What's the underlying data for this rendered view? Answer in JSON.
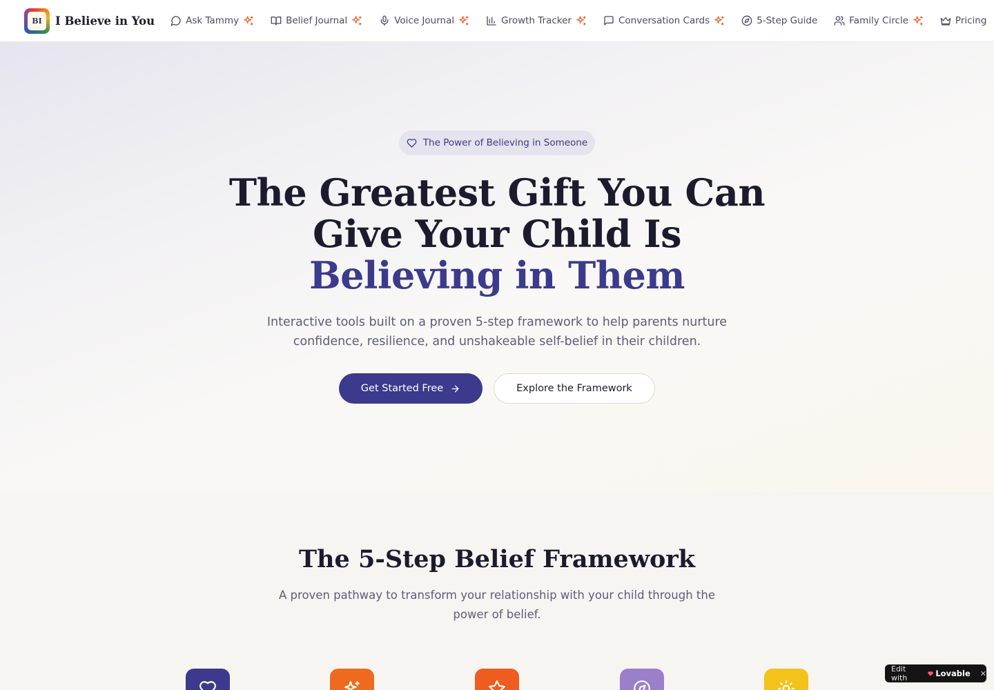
{
  "brand": {
    "logo_text": "BI",
    "name": "I Believe in You"
  },
  "nav": {
    "items": [
      {
        "label": "Ask Tammy",
        "icon": "message-circle-icon",
        "premium": true
      },
      {
        "label": "Belief Journal",
        "icon": "book-open-icon",
        "premium": true
      },
      {
        "label": "Voice Journal",
        "icon": "mic-icon",
        "premium": true
      },
      {
        "label": "Growth Tracker",
        "icon": "bar-chart-icon",
        "premium": true
      },
      {
        "label": "Conversation Cards",
        "icon": "message-square-icon",
        "premium": true
      },
      {
        "label": "5-Step Guide",
        "icon": "compass-icon",
        "premium": false
      },
      {
        "label": "Family Circle",
        "icon": "users-icon",
        "premium": true
      },
      {
        "label": "Pricing",
        "icon": "crown-icon",
        "premium": false
      }
    ],
    "accent_spark_color": "#e8632b"
  },
  "hero": {
    "pill": "The Power of Believing in Someone",
    "title_line1": "The Greatest Gift You Can",
    "title_line2": "Give Your Child Is",
    "title_accent": "Believing in Them",
    "subtitle": "Interactive tools built on a proven 5-step framework to help parents nurture confidence, resilience, and unshakeable self-belief in their children.",
    "primary_button": "Get Started Free",
    "secondary_button": "Explore the Framework"
  },
  "framework": {
    "title": "The 5-Step Belief Framework",
    "subtitle": "A proven pathway to transform your relationship with your child through the power of belief.",
    "steps": [
      {
        "icon": "heart-icon",
        "color": "#3b3a8c"
      },
      {
        "icon": "sparkles-icon",
        "color": "#ee6a1f"
      },
      {
        "icon": "star-icon",
        "color": "#ee5c1f"
      },
      {
        "icon": "compass-icon",
        "color": "#9b7fcb"
      },
      {
        "icon": "sun-icon",
        "color": "#f3c21b"
      }
    ]
  },
  "badge": {
    "prefix": "Edit with",
    "brand": "Lovable",
    "close": "✕"
  },
  "colors": {
    "primary": "#3b3a8c",
    "text": "#1c1b2e",
    "muted": "#5e5c78"
  }
}
